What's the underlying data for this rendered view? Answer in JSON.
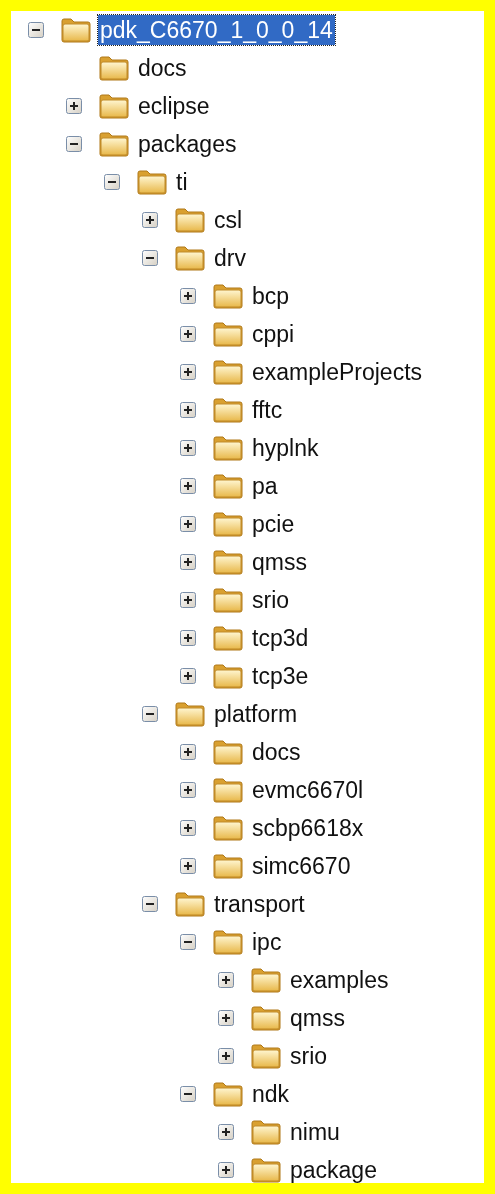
{
  "tree": [
    {
      "label": "pdk_C6670_1_0_0_14",
      "kind": "folder",
      "expanded": true,
      "selected": true,
      "children": [
        {
          "label": "docs",
          "kind": "leaf",
          "selected": false
        },
        {
          "label": "eclipse",
          "kind": "folder",
          "expanded": false,
          "selected": false
        },
        {
          "label": "packages",
          "kind": "folder",
          "expanded": true,
          "selected": false,
          "children": [
            {
              "label": "ti",
              "kind": "folder",
              "expanded": true,
              "selected": false,
              "children": [
                {
                  "label": "csl",
                  "kind": "folder",
                  "expanded": false,
                  "selected": false
                },
                {
                  "label": "drv",
                  "kind": "folder",
                  "expanded": true,
                  "selected": false,
                  "children": [
                    {
                      "label": "bcp",
                      "kind": "folder",
                      "expanded": false,
                      "selected": false
                    },
                    {
                      "label": "cppi",
                      "kind": "folder",
                      "expanded": false,
                      "selected": false
                    },
                    {
                      "label": "exampleProjects",
                      "kind": "folder",
                      "expanded": false,
                      "selected": false
                    },
                    {
                      "label": "fftc",
                      "kind": "folder",
                      "expanded": false,
                      "selected": false
                    },
                    {
                      "label": "hyplnk",
                      "kind": "folder",
                      "expanded": false,
                      "selected": false
                    },
                    {
                      "label": "pa",
                      "kind": "folder",
                      "expanded": false,
                      "selected": false
                    },
                    {
                      "label": "pcie",
                      "kind": "folder",
                      "expanded": false,
                      "selected": false
                    },
                    {
                      "label": "qmss",
                      "kind": "folder",
                      "expanded": false,
                      "selected": false
                    },
                    {
                      "label": "srio",
                      "kind": "folder",
                      "expanded": false,
                      "selected": false
                    },
                    {
                      "label": "tcp3d",
                      "kind": "folder",
                      "expanded": false,
                      "selected": false
                    },
                    {
                      "label": "tcp3e",
                      "kind": "folder",
                      "expanded": false,
                      "selected": false
                    }
                  ]
                },
                {
                  "label": "platform",
                  "kind": "folder",
                  "expanded": true,
                  "selected": false,
                  "children": [
                    {
                      "label": "docs",
                      "kind": "folder",
                      "expanded": false,
                      "selected": false
                    },
                    {
                      "label": "evmc6670l",
                      "kind": "folder",
                      "expanded": false,
                      "selected": false
                    },
                    {
                      "label": "scbp6618x",
                      "kind": "folder",
                      "expanded": false,
                      "selected": false
                    },
                    {
                      "label": "simc6670",
                      "kind": "folder",
                      "expanded": false,
                      "selected": false
                    }
                  ]
                },
                {
                  "label": "transport",
                  "kind": "folder",
                  "expanded": true,
                  "selected": false,
                  "children": [
                    {
                      "label": "ipc",
                      "kind": "folder",
                      "expanded": true,
                      "selected": false,
                      "children": [
                        {
                          "label": "examples",
                          "kind": "folder",
                          "expanded": false,
                          "selected": false
                        },
                        {
                          "label": "qmss",
                          "kind": "folder",
                          "expanded": false,
                          "selected": false
                        },
                        {
                          "label": "srio",
                          "kind": "folder",
                          "expanded": false,
                          "selected": false
                        }
                      ]
                    },
                    {
                      "label": "ndk",
                      "kind": "folder",
                      "expanded": true,
                      "selected": false,
                      "children": [
                        {
                          "label": "nimu",
                          "kind": "folder",
                          "expanded": false,
                          "selected": false
                        },
                        {
                          "label": "package",
                          "kind": "folder",
                          "expanded": false,
                          "selected": false
                        }
                      ]
                    }
                  ]
                }
              ]
            }
          ]
        }
      ]
    }
  ]
}
